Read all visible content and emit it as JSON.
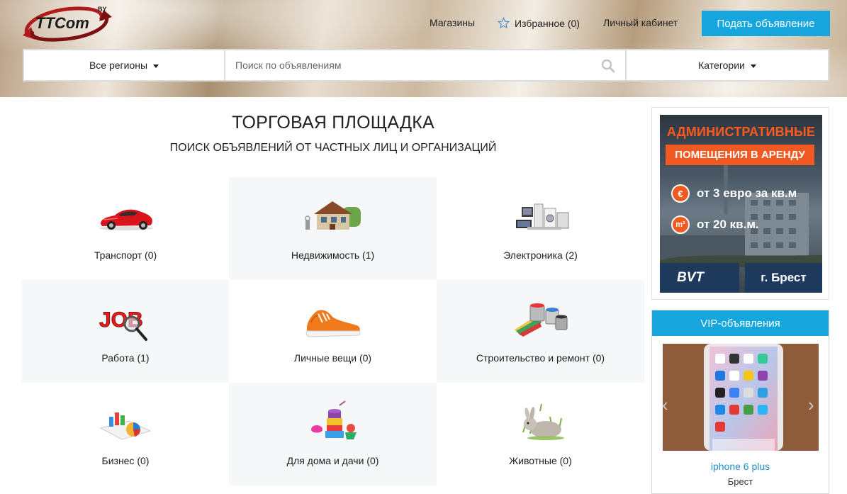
{
  "header": {
    "logo_text": "TTCom",
    "logo_suffix": "BY",
    "nav": {
      "shops": "Магазины",
      "favorites": "Избранное (0)",
      "account": "Личный кабинет"
    },
    "post_button": "Подать объявление"
  },
  "search": {
    "region_label": "Все регионы",
    "placeholder": "Поиск по объявлениям",
    "categories_label": "Категории"
  },
  "main": {
    "title": "ТОРГОВАЯ ПЛОЩАДКА",
    "subtitle": "ПОИСК ОБЪЯВЛЕНИЙ ОТ ЧАСТНЫХ ЛИЦ И ОРГАНИЗАЦИЙ",
    "categories": [
      {
        "label": "Транспорт (0)",
        "icon": "car-icon"
      },
      {
        "label": "Недвижимость (1)",
        "icon": "house-icon"
      },
      {
        "label": "Электроника (2)",
        "icon": "electronics-icon"
      },
      {
        "label": "Работа (1)",
        "icon": "job-icon"
      },
      {
        "label": "Личные вещи (0)",
        "icon": "sneaker-icon"
      },
      {
        "label": "Строительство и ремонт (0)",
        "icon": "paint-icon"
      },
      {
        "label": "Бизнес (0)",
        "icon": "chart-icon"
      },
      {
        "label": "Для дома и дачи (0)",
        "icon": "home-goods-icon"
      },
      {
        "label": "Животные (0)",
        "icon": "rabbit-icon"
      }
    ]
  },
  "sidebar": {
    "ad": {
      "line1": "АДМИНИСТРАТИВНЫЕ",
      "line2": "ПОМЕЩЕНИЯ В АРЕНДУ",
      "row1_icon": "€",
      "row1": "от 3 евро за кв.м",
      "row2_icon": "m²",
      "row2": "от 20 кв.м.",
      "brand": "BVT",
      "city": "г. Брест"
    },
    "vip": {
      "header": "VIP-объявления",
      "item_title": "iphone 6 plus",
      "item_city": "Брест"
    }
  },
  "colors": {
    "accent": "#16a6dd",
    "ad_orange": "#f05a22",
    "ad_navy": "#1d3a5c",
    "link": "#1e8fc6"
  }
}
